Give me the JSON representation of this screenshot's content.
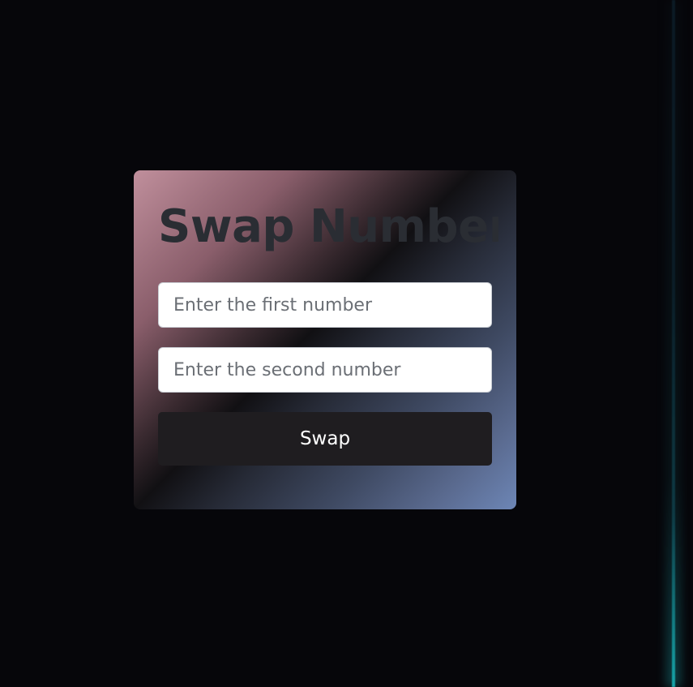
{
  "card": {
    "title": "Swap Numbers",
    "first_input": {
      "value": "",
      "placeholder": "Enter the first number"
    },
    "second_input": {
      "value": "",
      "placeholder": "Enter the second number"
    },
    "swap_button_label": "Swap"
  },
  "colors": {
    "page_background": "#06060a",
    "gradient_start": "#c08f9c",
    "gradient_middle": "#111013",
    "gradient_end": "#6d86b6",
    "title_color": "#2a2d33",
    "button_background": "#1f1d20",
    "edge_glow": "#16a4a8"
  }
}
